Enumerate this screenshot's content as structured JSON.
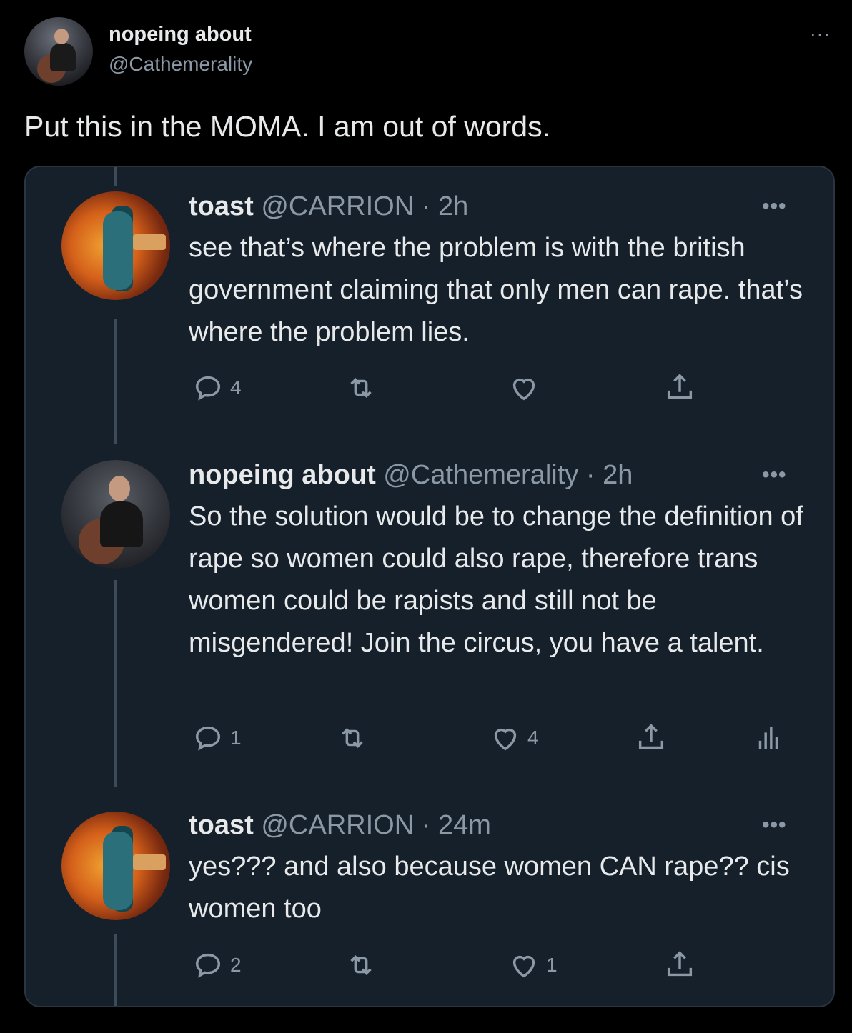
{
  "post": {
    "author_name": "nopeing about",
    "author_handle": "@Cathemerality",
    "more": "···",
    "text": "Put this in the MOMA. I am out of words."
  },
  "thread": [
    {
      "name": "toast",
      "handle": "@CARRION",
      "time": "· 2h",
      "more": "•••",
      "text": "see that’s where the problem is with the british government claiming that only men can rape. that’s where the problem lies.",
      "replies": "4",
      "retweets": "",
      "likes": "",
      "avatar": "toast-avatar"
    },
    {
      "name": "nopeing about",
      "handle": "@Cathemerality",
      "time": "· 2h",
      "more": "•••",
      "text": "So the solution would be to change the definition of rape so women could also rape, therefore trans women could be rapists and still not be misgendered! Join the circus, you have a talent.",
      "replies": "1",
      "retweets": "",
      "likes": "4",
      "avatar": "nopeing-avatar"
    },
    {
      "name": "toast",
      "handle": "@CARRION",
      "time": "· 24m",
      "more": "•••",
      "text": "yes??? and also because women CAN rape?? cis women too",
      "replies": "2",
      "retweets": "",
      "likes": "1",
      "avatar": "toast-avatar"
    }
  ],
  "icons": [
    "reply-icon",
    "retweet-icon",
    "like-icon",
    "share-icon",
    "analytics-icon",
    "more-icon"
  ]
}
